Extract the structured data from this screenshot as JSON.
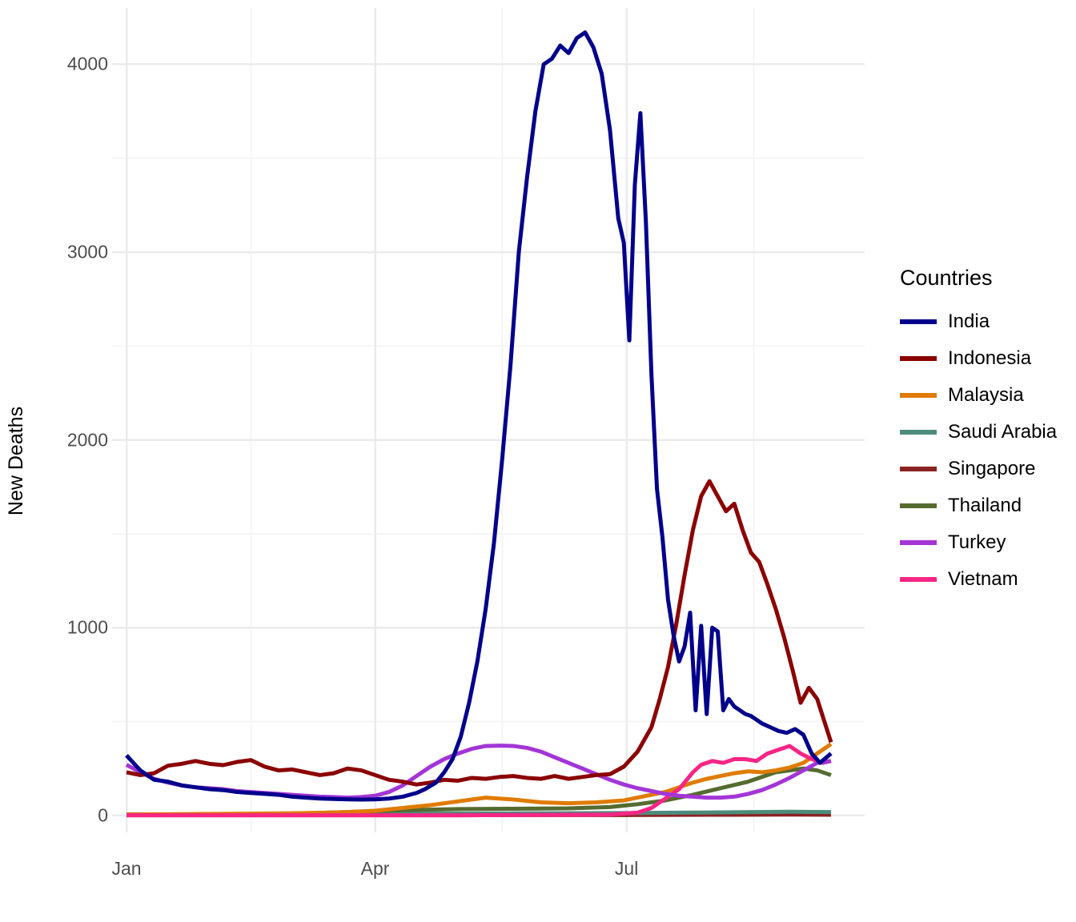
{
  "chart_data": {
    "type": "line",
    "title": "",
    "xlabel": "",
    "ylabel": "New Deaths",
    "legend_title": "Countries",
    "legend_position": "right",
    "grid": true,
    "x_axis": {
      "type": "date",
      "tick_labels": [
        "Jan",
        "Apr",
        "Jul"
      ],
      "tick_values": [
        0,
        90,
        181
      ],
      "minor_ticks": [
        45,
        136,
        227
      ],
      "range": [
        0,
        255
      ],
      "range_note": "day-of-year, Jan 1 through mid-September"
    },
    "y_axis": {
      "tick_labels": [
        "0",
        "1000",
        "2000",
        "3000",
        "4000"
      ],
      "tick_values": [
        0,
        1000,
        2000,
        3000,
        4000
      ],
      "minor_ticks": [
        500,
        1500,
        2500,
        3500
      ],
      "ylim": [
        -90,
        4300
      ]
    },
    "series": [
      {
        "name": "India",
        "color": "#00008B",
        "x": [
          0,
          5,
          10,
          15,
          20,
          25,
          30,
          35,
          40,
          45,
          50,
          55,
          60,
          65,
          70,
          75,
          80,
          85,
          90,
          95,
          100,
          105,
          108,
          112,
          115,
          118,
          121,
          124,
          127,
          130,
          133,
          136,
          139,
          142,
          145,
          148,
          151,
          154,
          157,
          160,
          163,
          166,
          169,
          172,
          175,
          178,
          180,
          182,
          184,
          186,
          188,
          190,
          192,
          194,
          196,
          198,
          200,
          202,
          204,
          206,
          208,
          210,
          212,
          214,
          216,
          218,
          220,
          222,
          224,
          226,
          228,
          230,
          233,
          236,
          239,
          242,
          245,
          248,
          251,
          255
        ],
        "y": [
          320,
          240,
          190,
          180,
          160,
          150,
          140,
          135,
          125,
          120,
          115,
          110,
          100,
          95,
          90,
          88,
          86,
          85,
          86,
          90,
          100,
          120,
          140,
          175,
          230,
          300,
          420,
          600,
          820,
          1100,
          1450,
          1900,
          2400,
          3000,
          3400,
          3750,
          4000,
          4030,
          4100,
          4060,
          4140,
          4170,
          4090,
          3950,
          3650,
          3180,
          3050,
          2530,
          3360,
          3740,
          3160,
          2350,
          1740,
          1480,
          1150,
          960,
          820,
          900,
          1080,
          560,
          1010,
          540,
          1000,
          980,
          560,
          620,
          580,
          560,
          540,
          530,
          510,
          490,
          470,
          450,
          440,
          460,
          430,
          330,
          280,
          330
        ],
        "peak": {
          "value": 4170,
          "x": 166
        }
      },
      {
        "name": "Indonesia",
        "color": "#8B0000",
        "x": [
          0,
          5,
          10,
          15,
          20,
          25,
          30,
          35,
          40,
          45,
          50,
          55,
          60,
          65,
          70,
          75,
          80,
          85,
          90,
          95,
          100,
          105,
          110,
          115,
          120,
          125,
          130,
          135,
          140,
          145,
          150,
          155,
          160,
          165,
          170,
          175,
          180,
          185,
          190,
          193,
          196,
          199,
          202,
          205,
          208,
          211,
          214,
          217,
          220,
          223,
          226,
          229,
          232,
          235,
          238,
          241,
          244,
          247,
          250,
          255
        ],
        "y": [
          230,
          215,
          225,
          265,
          275,
          290,
          275,
          268,
          285,
          295,
          260,
          240,
          245,
          230,
          215,
          225,
          250,
          240,
          215,
          190,
          180,
          165,
          175,
          190,
          185,
          200,
          195,
          205,
          210,
          200,
          195,
          210,
          195,
          205,
          215,
          220,
          260,
          340,
          470,
          620,
          790,
          1020,
          1280,
          1520,
          1700,
          1780,
          1700,
          1620,
          1660,
          1520,
          1400,
          1350,
          1230,
          1100,
          950,
          780,
          600,
          680,
          620,
          390
        ],
        "peak": {
          "value": 1780,
          "x": 211
        }
      },
      {
        "name": "Malaysia",
        "color": "#E07B00",
        "x": [
          0,
          10,
          20,
          30,
          40,
          50,
          60,
          70,
          80,
          90,
          100,
          110,
          120,
          130,
          140,
          150,
          160,
          170,
          180,
          185,
          190,
          195,
          200,
          205,
          210,
          215,
          220,
          225,
          230,
          235,
          240,
          245,
          250,
          255
        ],
        "y": [
          5,
          6,
          7,
          8,
          9,
          10,
          12,
          14,
          18,
          25,
          40,
          55,
          75,
          95,
          85,
          70,
          65,
          70,
          80,
          95,
          110,
          125,
          150,
          175,
          195,
          210,
          225,
          235,
          230,
          240,
          255,
          280,
          330,
          380
        ],
        "peak": {
          "value": 380,
          "x": 255
        }
      },
      {
        "name": "Saudi Arabia",
        "color": "#4D8C7C",
        "x": [
          0,
          20,
          40,
          60,
          80,
          100,
          120,
          140,
          160,
          180,
          200,
          220,
          240,
          255
        ],
        "y": [
          6,
          6,
          7,
          8,
          8,
          9,
          10,
          11,
          12,
          13,
          15,
          17,
          20,
          18
        ],
        "peak": {
          "value": 20,
          "x": 240
        }
      },
      {
        "name": "Singapore",
        "color": "#8B2222",
        "x": [
          0,
          20,
          40,
          60,
          80,
          100,
          120,
          140,
          160,
          180,
          200,
          220,
          240,
          255
        ],
        "y": [
          1,
          1,
          1,
          1,
          1,
          1,
          1,
          2,
          2,
          2,
          3,
          4,
          5,
          4
        ],
        "peak": {
          "value": 5,
          "x": 240
        }
      },
      {
        "name": "Thailand",
        "color": "#556B2F",
        "x": [
          0,
          20,
          40,
          60,
          80,
          100,
          120,
          140,
          160,
          175,
          185,
          195,
          205,
          215,
          225,
          235,
          245,
          250,
          255
        ],
        "y": [
          3,
          4,
          6,
          10,
          18,
          28,
          34,
          36,
          38,
          45,
          60,
          80,
          110,
          145,
          180,
          230,
          250,
          240,
          215
        ],
        "peak": {
          "value": 252,
          "x": 238
        }
      },
      {
        "name": "Turkey",
        "color": "#A335D6",
        "x": [
          0,
          5,
          10,
          15,
          20,
          25,
          30,
          35,
          40,
          45,
          50,
          55,
          60,
          65,
          70,
          75,
          80,
          85,
          90,
          95,
          100,
          105,
          110,
          115,
          120,
          125,
          130,
          135,
          140,
          145,
          150,
          155,
          160,
          165,
          170,
          175,
          180,
          185,
          190,
          195,
          200,
          205,
          210,
          215,
          220,
          225,
          230,
          235,
          240,
          245,
          250,
          255
        ],
        "y": [
          270,
          230,
          195,
          175,
          160,
          150,
          145,
          140,
          130,
          125,
          120,
          115,
          110,
          105,
          100,
          98,
          95,
          98,
          105,
          125,
          160,
          210,
          260,
          300,
          330,
          355,
          370,
          372,
          370,
          360,
          340,
          310,
          280,
          250,
          220,
          190,
          165,
          145,
          130,
          115,
          105,
          100,
          95,
          95,
          100,
          115,
          135,
          165,
          200,
          240,
          280,
          290
        ],
        "peak": {
          "value": 372,
          "x": 135
        }
      },
      {
        "name": "Vietnam",
        "color": "#F72585",
        "x": [
          0,
          20,
          40,
          60,
          80,
          100,
          120,
          140,
          160,
          175,
          185,
          190,
          195,
          200,
          205,
          208,
          212,
          216,
          220,
          224,
          228,
          232,
          236,
          240,
          244,
          248,
          252,
          255
        ],
        "y": [
          1,
          1,
          1,
          1,
          1,
          1,
          1,
          2,
          3,
          5,
          15,
          40,
          90,
          140,
          230,
          270,
          290,
          280,
          300,
          300,
          290,
          330,
          350,
          370,
          330,
          300,
          280,
          290
        ],
        "peak": {
          "value": 372,
          "x": 240
        }
      }
    ]
  },
  "axes": {
    "y_label": "New Deaths",
    "y_ticks": [
      "0",
      "1000",
      "2000",
      "3000",
      "4000"
    ],
    "x_ticks": [
      "Jan",
      "Apr",
      "Jul"
    ]
  },
  "legend": {
    "title": "Countries",
    "items": [
      {
        "label": "India",
        "color": "#00008B"
      },
      {
        "label": "Indonesia",
        "color": "#8B0000"
      },
      {
        "label": "Malaysia",
        "color": "#E07B00"
      },
      {
        "label": "Saudi Arabia",
        "color": "#4D8C7C"
      },
      {
        "label": "Singapore",
        "color": "#8B2222"
      },
      {
        "label": "Thailand",
        "color": "#556B2F"
      },
      {
        "label": "Turkey",
        "color": "#A335D6"
      },
      {
        "label": "Vietnam",
        "color": "#F72585"
      }
    ]
  },
  "theme": {
    "panel_background": "#FFFFFF",
    "major_grid": "#EBEBEB",
    "minor_grid": "#F5F5F5",
    "tick_text": "#4D4D4D",
    "axis_title": "#000000"
  }
}
